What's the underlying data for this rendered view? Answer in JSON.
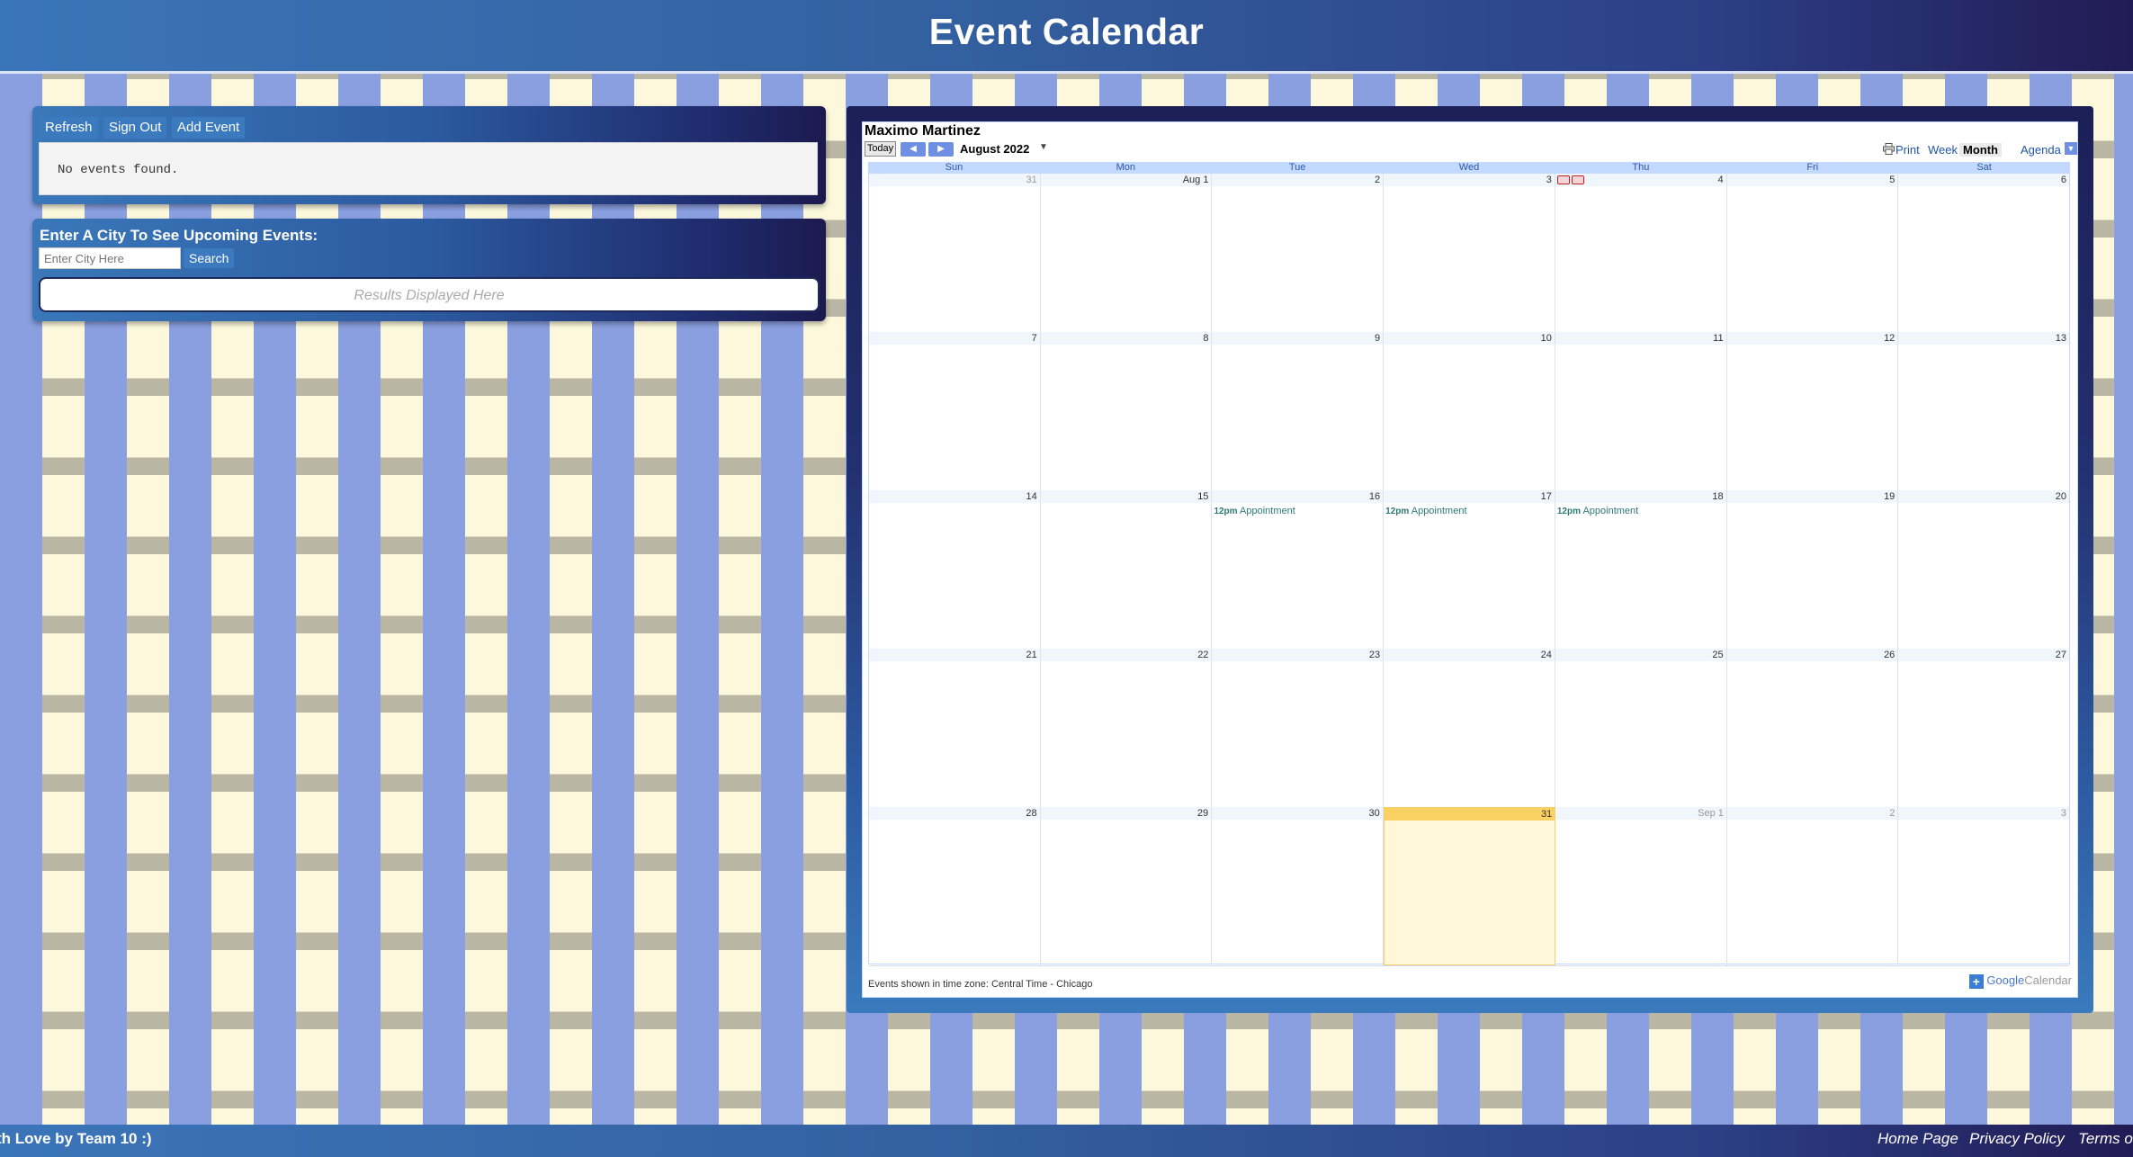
{
  "header": {
    "title": "Event Calendar"
  },
  "actions": {
    "refresh": "Refresh",
    "sign_out": "Sign Out",
    "add_event": "Add Event",
    "empty_message": "No events found."
  },
  "city_search": {
    "label": "Enter A City To See Upcoming Events:",
    "placeholder": "Enter City Here",
    "button": "Search",
    "results_placeholder": "Results Displayed Here"
  },
  "calendar": {
    "owner": "Maximo Martinez",
    "today_label": "Today",
    "month_label": "August 2022",
    "print_label": "Print",
    "views": [
      "Week",
      "Month",
      "Agenda"
    ],
    "active_view": "Month",
    "days_of_week": [
      "Sun",
      "Mon",
      "Tue",
      "Wed",
      "Thu",
      "Fri",
      "Sat"
    ],
    "weeks": [
      [
        {
          "label": "31",
          "other": true
        },
        {
          "label": "Aug 1"
        },
        {
          "label": "2"
        },
        {
          "label": "3"
        },
        {
          "label": "4",
          "holiday": true
        },
        {
          "label": "5"
        },
        {
          "label": "6"
        }
      ],
      [
        {
          "label": "7"
        },
        {
          "label": "8"
        },
        {
          "label": "9"
        },
        {
          "label": "10"
        },
        {
          "label": "11"
        },
        {
          "label": "12"
        },
        {
          "label": "13"
        }
      ],
      [
        {
          "label": "14"
        },
        {
          "label": "15"
        },
        {
          "label": "16",
          "event": {
            "time": "12pm",
            "title": "Appointment"
          }
        },
        {
          "label": "17",
          "event": {
            "time": "12pm",
            "title": "Appointment"
          }
        },
        {
          "label": "18",
          "event": {
            "time": "12pm",
            "title": "Appointment"
          }
        },
        {
          "label": "19"
        },
        {
          "label": "20"
        }
      ],
      [
        {
          "label": "21"
        },
        {
          "label": "22"
        },
        {
          "label": "23"
        },
        {
          "label": "24"
        },
        {
          "label": "25"
        },
        {
          "label": "26"
        },
        {
          "label": "27"
        }
      ],
      [
        {
          "label": "28"
        },
        {
          "label": "29"
        },
        {
          "label": "30"
        },
        {
          "label": "31",
          "today": true
        },
        {
          "label": "Sep 1",
          "other": true
        },
        {
          "label": "2",
          "other": true
        },
        {
          "label": "3",
          "other": true
        }
      ]
    ],
    "timezone_note": "Events shown in time zone: Central Time - Chicago",
    "branding": {
      "google": "Google",
      "calendar": "Calendar"
    }
  },
  "footer": {
    "credit": "th Love by Team 10 :)",
    "links": [
      "Home Page",
      "Privacy Policy",
      "Terms o"
    ]
  },
  "colors": {
    "accent_blue": "#3c7ac0",
    "today_highlight": "#fad163",
    "event_text": "#2d7a7a"
  }
}
